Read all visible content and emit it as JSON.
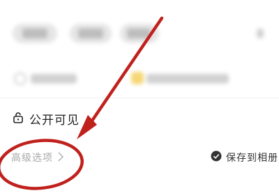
{
  "visibility": {
    "label": "公开可见",
    "icon": "lock-open-icon"
  },
  "advanced": {
    "label": "高级选项",
    "icon": "chevron-right-icon"
  },
  "save": {
    "label": "保存到相册",
    "icon": "check-circle-icon",
    "checked": true
  },
  "annotation": {
    "color": "#c0211c"
  }
}
